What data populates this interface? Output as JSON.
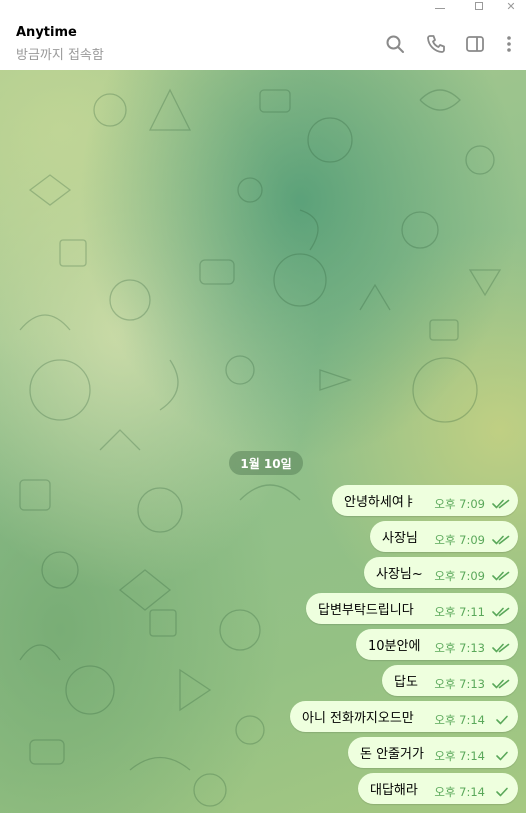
{
  "window_controls": [
    "minimize",
    "maximize",
    "close"
  ],
  "header": {
    "title": "Anytime",
    "status": "방금까지 접속함",
    "icons": [
      "search-icon",
      "phone-icon",
      "sidebar-toggle-icon",
      "more-icon"
    ]
  },
  "date_separator": "1월 10일",
  "messages": [
    {
      "text": "안녕하세여ㅑ",
      "time": "오후 7:09",
      "read": true
    },
    {
      "text": "사장님",
      "time": "오후 7:09",
      "read": true
    },
    {
      "text": "사장님~",
      "time": "오후 7:09",
      "read": true
    },
    {
      "text": "답변부탁드립니다",
      "time": "오후 7:11",
      "read": true
    },
    {
      "text": "10분안에",
      "time": "오후 7:13",
      "read": true
    },
    {
      "text": "답도",
      "time": "오후 7:13",
      "read": true
    },
    {
      "text": "아니 전화까지오드만",
      "time": "오후 7:14",
      "read": false
    },
    {
      "text": "돈 안줄거가",
      "time": "오후 7:14",
      "read": false
    },
    {
      "text": "대답해라",
      "time": "오후 7:14",
      "read": false
    }
  ],
  "colors": {
    "outgoing_bubble": "#eeffde",
    "time_text": "#5aa85a",
    "date_chip": "#5a825a"
  }
}
